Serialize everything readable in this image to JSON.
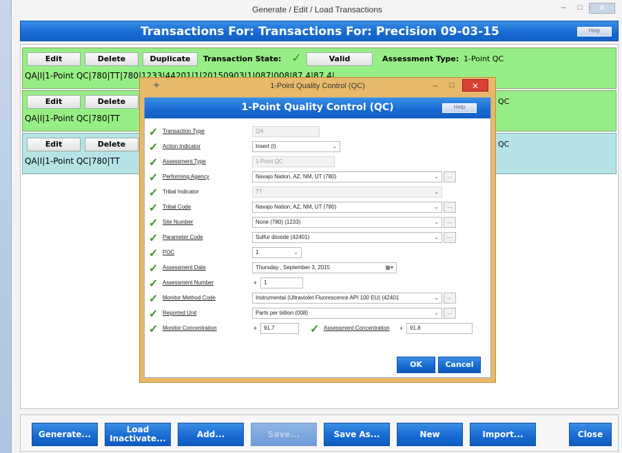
{
  "window": {
    "title": "Generate / Edit / Load Transactions",
    "header_title": "Transactions For: Transactions For: Precision 09-03-15",
    "help_label": "Help",
    "min_glyph": "–",
    "max_glyph": "□",
    "close_glyph": "✕"
  },
  "transactions": [
    {
      "edit": "Edit",
      "delete": "Delete",
      "duplicate": "Duplicate",
      "state_label": "Transaction State:",
      "state_value": "Valid",
      "type_label": "Assessment Type:",
      "type_value": "1-Point QC",
      "data": "QA|I|1-Point QC|780|TT|780|1233|44201|1|20150903|1|087|008|87.4|87.4|"
    },
    {
      "edit": "Edit",
      "delete": "Delete",
      "data": "QA|I|1-Point QC|780|TT",
      "type_tail": "QC"
    },
    {
      "edit": "Edit",
      "delete": "Delete",
      "data": "QA|I|1-Point QC|780|TT",
      "type_tail": "QC"
    }
  ],
  "bottom_buttons": [
    {
      "label": "Generate..."
    },
    {
      "label": "Load Inactivate..."
    },
    {
      "label": "Add..."
    },
    {
      "label": "Save..."
    },
    {
      "label": "Save As..."
    },
    {
      "label": "New"
    },
    {
      "label": "Import..."
    },
    {
      "label": "Close"
    }
  ],
  "dialog": {
    "window_title": "1-Point Quality Control (QC)",
    "header_title": "1-Point Quality Control (QC)",
    "help_label": "Help",
    "fields": [
      {
        "label": "Transaction Type",
        "value": "QA"
      },
      {
        "label": "Action Indicator",
        "value": "Insert (I)"
      },
      {
        "label": "Assessment Type",
        "value": "1-Point QC"
      },
      {
        "label": "Performing Agency",
        "value": "Navajo Nation, AZ, NM, UT (780)"
      },
      {
        "label": "Tribal Indicator",
        "value": "TT"
      },
      {
        "label": "Tribal Code",
        "value": "Navajo Nation, AZ, NM, UT (780)"
      },
      {
        "label": "Site Number",
        "value": "None (780) (1233)"
      },
      {
        "label": "Parameter Code",
        "value": "Sulfur dioxide (42401)"
      },
      {
        "label": "POC",
        "value": "1"
      },
      {
        "label": "Assessment Date",
        "value": "Thursday , September  3, 2015"
      },
      {
        "label": "Assessment Number",
        "value": "1"
      },
      {
        "label": "Monitor Method Code",
        "value": "Instrumental (Ultraviolet Fluorescence API 100 EU) (42401"
      },
      {
        "label": "Reported Unit",
        "value": "Parts per billion (008)"
      },
      {
        "label": "Monitor Concentration",
        "value": "91.7"
      }
    ],
    "assessment_concentration_label": "Assessment Concentration",
    "assessment_concentration_value": "91.8",
    "ok": "OK",
    "cancel": "Cancel"
  }
}
